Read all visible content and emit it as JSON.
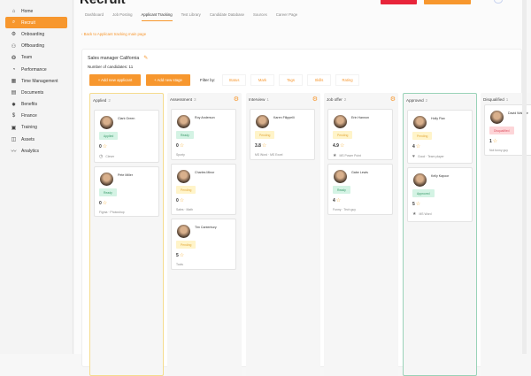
{
  "sidebar": {
    "items": [
      {
        "icon": "home-icon",
        "glyph": "⌂",
        "label": "Home"
      },
      {
        "icon": "search-icon",
        "glyph": "⌕",
        "label": "Recruit",
        "active": true
      },
      {
        "icon": "onboarding-icon",
        "glyph": "⚙",
        "label": "Onboarding"
      },
      {
        "icon": "offboarding-icon",
        "glyph": "⚇",
        "label": "Offboarding"
      },
      {
        "icon": "team-icon",
        "glyph": "❂",
        "label": "Team"
      },
      {
        "icon": "performance-icon",
        "glyph": "◔",
        "label": "Performance"
      },
      {
        "icon": "time-management-icon",
        "glyph": "▦",
        "label": "Time Management"
      },
      {
        "icon": "documents-icon",
        "glyph": "▤",
        "label": "Documents"
      },
      {
        "icon": "benefits-icon",
        "glyph": "✸",
        "label": "Benefits"
      },
      {
        "icon": "finance-icon",
        "glyph": "$",
        "label": "Finance"
      },
      {
        "icon": "training-icon",
        "glyph": "▣",
        "label": "Training"
      },
      {
        "icon": "assets-icon",
        "glyph": "◫",
        "label": "Assets"
      },
      {
        "icon": "analytics-icon",
        "glyph": "〰",
        "label": "Analytics"
      }
    ]
  },
  "header": {
    "title": "Recruit"
  },
  "tabs": [
    "Dashboard",
    "Job Posting",
    "Applicant Tracking",
    "Test Library",
    "Candidate Database",
    "Sources",
    "Career Page"
  ],
  "active_tab": "Applicant Tracking",
  "back_link": "Back to Applicant tracking main page",
  "job": {
    "title": "Sales manager California",
    "count_label": "Number of candidates:",
    "count": "11"
  },
  "buttons": {
    "add_applicant": "+ Add new applicant",
    "add_stage": "+ Add new stage"
  },
  "filter": {
    "label": "Filter by:",
    "options": [
      "Status",
      "Mark",
      "Tags",
      "Skills",
      "Rating"
    ]
  },
  "colors": {
    "accent": "#f7972e"
  },
  "columns": [
    {
      "name": "Applied",
      "count": "2",
      "style": "yellow",
      "gear": false,
      "cards": [
        {
          "name": "Clark Green",
          "status": "Applied",
          "badge": "green",
          "rating": "0",
          "tag_icon": "clock-icon",
          "tag_glyph": "◷",
          "tags": "Clever",
          "h": 60
        },
        {
          "name": "Pete Miller",
          "status": "Ready",
          "badge": "green",
          "rating": "0",
          "tags": "Figma · Photoshop",
          "h": 57
        }
      ]
    },
    {
      "name": "Assessment",
      "count": "3",
      "gear": true,
      "cards": [
        {
          "name": "Roy Anderson",
          "status": "Ready",
          "badge": "green",
          "rating": "0",
          "tags": "Sporty",
          "h": 58
        },
        {
          "name": "Charles Minor",
          "status": "Pending",
          "badge": "yel",
          "rating": "0",
          "tags": "Sales · Math",
          "h": 58
        },
        {
          "name": "Tim Canterbury",
          "status": "Pending",
          "badge": "yel",
          "rating": "5",
          "tags": "Tools",
          "h": 58
        }
      ]
    },
    {
      "name": "Interview",
      "count": "1",
      "gear": true,
      "cards": [
        {
          "name": "Karen Filippelli",
          "status": "Pending",
          "badge": "yel",
          "rating": "3.8",
          "tags": "MS Word · MS Excel",
          "h": 58
        }
      ]
    },
    {
      "name": "Job offer",
      "count": "2",
      "gear": true,
      "cards": [
        {
          "name": "Erin Hannon",
          "status": "Pending",
          "badge": "yel",
          "rating": "4.9",
          "tag_icon": "star-filled-icon",
          "tag_glyph": "★",
          "tags": "MS Power Point",
          "h": 58
        },
        {
          "name": "Gabe Lewis",
          "status": "Ready",
          "badge": "green",
          "rating": "4",
          "tags": "Funny · Tech guy",
          "h": 58
        }
      ]
    },
    {
      "name": "Approved",
      "count": "2",
      "style": "green",
      "gear": false,
      "cards": [
        {
          "name": "Holly Flax",
          "status": "Pending",
          "badge": "yel",
          "rating": "4",
          "tag_icon": "heart-icon",
          "tag_glyph": "♥",
          "tags": "Good · Team player",
          "h": 61
        },
        {
          "name": "Kelly Kapoor",
          "status": "Approved",
          "badge": "green",
          "rating": "5",
          "tag_icon": "star-filled-icon",
          "tag_glyph": "★",
          "tags": "MS Word",
          "h": 62
        }
      ]
    },
    {
      "name": "Disqualified",
      "count": "1",
      "gear": false,
      "cards": [
        {
          "name": "David Wallace",
          "status": "Disqualified",
          "badge": "red",
          "rating": "1",
          "tags": "Not funny guy",
          "h": 58
        }
      ]
    }
  ]
}
